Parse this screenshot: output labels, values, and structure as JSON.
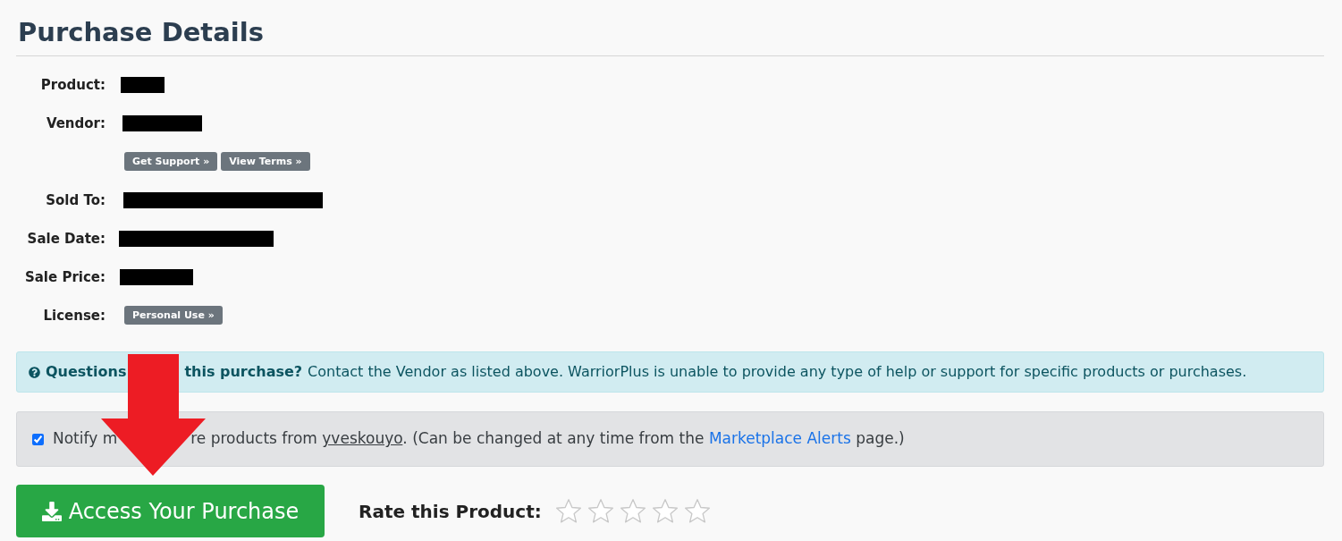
{
  "title": "Purchase Details",
  "details": [
    {
      "label": "Product:",
      "kind": "redacted"
    },
    {
      "label": "Vendor:",
      "kind": "redacted"
    },
    {
      "kind": "buttons",
      "buttons": [
        "Get Support »",
        "View Terms »"
      ]
    },
    {
      "label": "Sold To:",
      "kind": "redacted"
    },
    {
      "label": "Sale Date:",
      "kind": "redacted"
    },
    {
      "label": "Sale Price:",
      "kind": "redacted"
    },
    {
      "label": "License:",
      "kind": "buttons",
      "buttons": [
        "Personal Use »"
      ]
    }
  ],
  "alert": {
    "lead_1": "Questions",
    "lead_2": "this purchase?",
    "text": "Contact the Vendor as listed above. WarriorPlus is unable to provide any type of help or support for specific products or purchases."
  },
  "notify": {
    "checked": true,
    "lead": "Notify m",
    "text_1": "re products from",
    "vendor_link": "yveskouyo",
    "text_2": ". (Can be changed at any time from the",
    "alerts_link": "Marketplace Alerts",
    "text_3": "page.)"
  },
  "access_button": "Access Your Purchase",
  "rating": {
    "label": "Rate this Product:",
    "stars": 0
  }
}
